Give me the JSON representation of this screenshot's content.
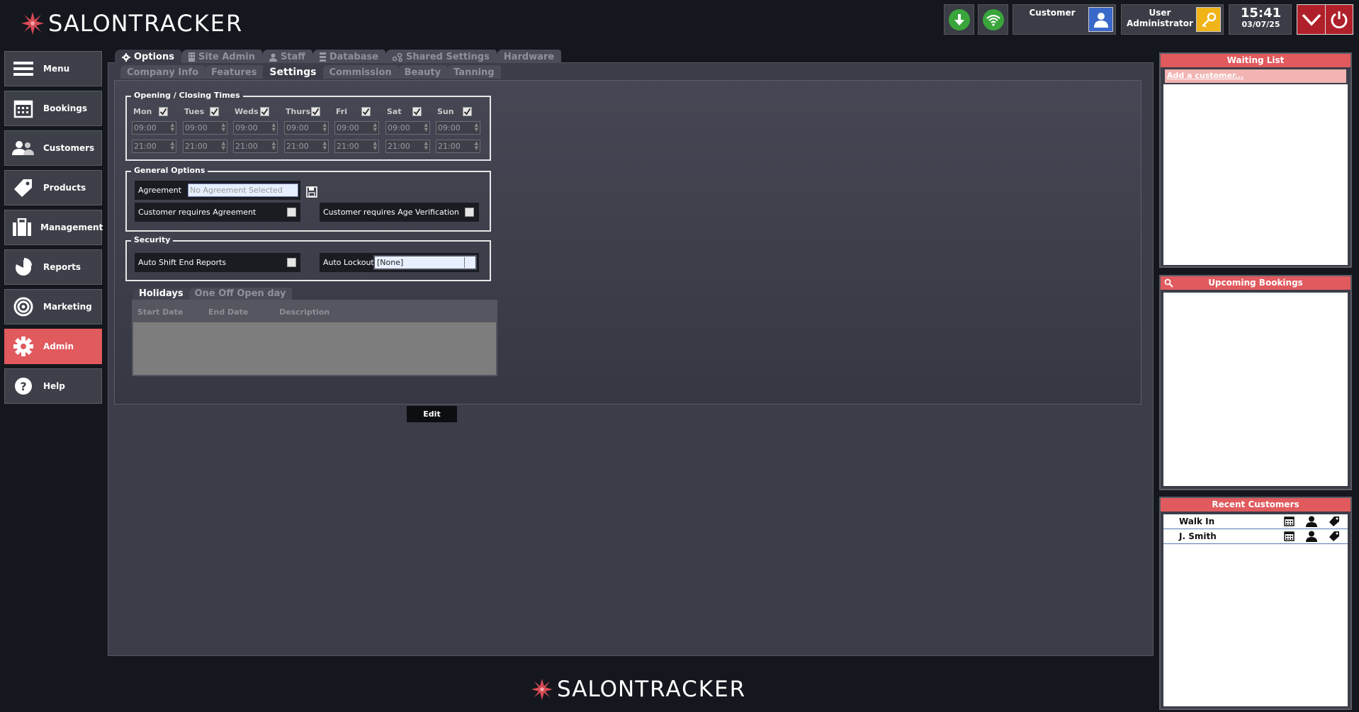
{
  "app": {
    "logo_part1": "SALON",
    "logo_part2": "TRACKER"
  },
  "topbar": {
    "customer_label": "Customer",
    "user_line1": "User",
    "user_line2": "Administrator",
    "time": "15:41",
    "date": "03/07/25"
  },
  "sidebar": {
    "items": [
      {
        "label": "Menu",
        "icon": "hamburger-icon"
      },
      {
        "label": "Bookings",
        "icon": "calendar-icon"
      },
      {
        "label": "Customers",
        "icon": "users-icon"
      },
      {
        "label": "Products",
        "icon": "tag-icon"
      },
      {
        "label": "Management",
        "icon": "briefcase-icon"
      },
      {
        "label": "Reports",
        "icon": "pie-chart-icon"
      },
      {
        "label": "Marketing",
        "icon": "target-icon"
      },
      {
        "label": "Admin",
        "icon": "gear-icon"
      },
      {
        "label": "Help",
        "icon": "question-icon"
      }
    ]
  },
  "tabs_main": {
    "options": "Options",
    "site_admin": "Site Admin",
    "staff": "Staff",
    "database": "Database",
    "shared_settings": "Shared Settings",
    "hardware": "Hardware"
  },
  "tabs_sub": {
    "company_info": "Company Info",
    "features": "Features",
    "settings": "Settings",
    "commission": "Commission",
    "beauty": "Beauty",
    "tanning": "Tanning"
  },
  "opening": {
    "title": "Opening / Closing Times",
    "days": [
      {
        "label": "Mon",
        "open": "09:00",
        "close": "21:00"
      },
      {
        "label": "Tues",
        "open": "09:00",
        "close": "21:00"
      },
      {
        "label": "Weds",
        "open": "09:00",
        "close": "21:00"
      },
      {
        "label": "Thurs",
        "open": "09:00",
        "close": "21:00"
      },
      {
        "label": "Fri",
        "open": "09:00",
        "close": "21:00"
      },
      {
        "label": "Sat",
        "open": "09:00",
        "close": "21:00"
      },
      {
        "label": "Sun",
        "open": "09:00",
        "close": "21:00"
      }
    ]
  },
  "general": {
    "title": "General Options",
    "agreement_label": "Agreement",
    "agreement_placeholder": "No Agreement Selected",
    "requires_agreement": "Customer requires Agreement",
    "requires_age": "Customer requires Age Verification"
  },
  "security": {
    "title": "Security",
    "auto_shift": "Auto Shift End Reports",
    "auto_lockout": "Auto Lockout",
    "auto_lockout_value": "[None]"
  },
  "holidays": {
    "tab_holidays": "Holidays",
    "tab_oneoff": "One Off Open day",
    "col_start": "Start Date",
    "col_end": "End Date",
    "col_desc": "Description"
  },
  "edit_label": "Edit",
  "right": {
    "waiting_title": "Waiting List",
    "add_customer": "Add a customer...",
    "upcoming_title": "Upcoming Bookings",
    "recent_title": "Recent Customers",
    "recent": [
      "Walk In",
      "J. Smith"
    ]
  },
  "colors": {
    "accent": "#e05a5e",
    "background": "#15171e",
    "panel": "#3b3d48"
  }
}
